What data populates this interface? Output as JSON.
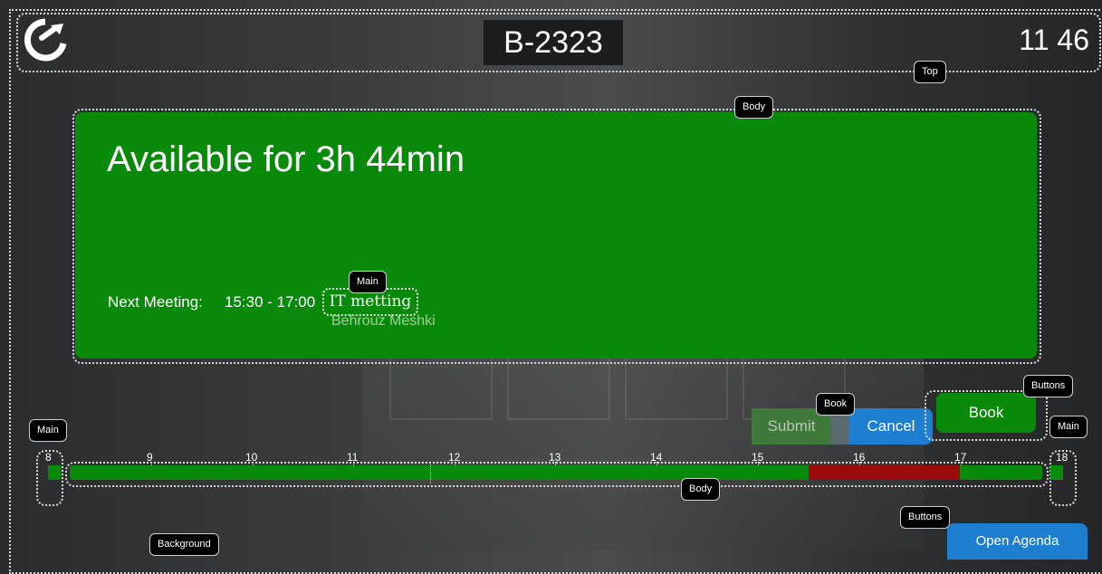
{
  "header": {
    "room_name": "B-2323",
    "clock": "11 46",
    "logo_icon": "calendar-clock-logo-icon"
  },
  "status": {
    "title": "Available for 3h 44min",
    "next_meeting_label": "Next Meeting:",
    "next_meeting_time": "15:30 - 17:00",
    "meeting_title": "IT metting",
    "organizer": "Behrouz Meshki",
    "color": "#0a8a0a"
  },
  "actions": {
    "submit_label": "Submit",
    "cancel_label": "Cancel",
    "book_label": "Book",
    "open_agenda_label": "Open Agenda"
  },
  "timeline": {
    "hours": [
      "8",
      "9",
      "10",
      "11",
      "12",
      "13",
      "14",
      "15",
      "16",
      "17",
      "18"
    ],
    "busy_color": "#9b0b0b",
    "free_color": "#0a8a0a"
  },
  "layout_tags": {
    "top": "Top",
    "body_upper": "Body",
    "main_meeting": "Main",
    "book": "Book",
    "buttons_upper": "Buttons",
    "main_left": "Main",
    "main_right": "Main",
    "body_lower": "Body",
    "buttons_lower": "Buttons",
    "background": "Background"
  }
}
